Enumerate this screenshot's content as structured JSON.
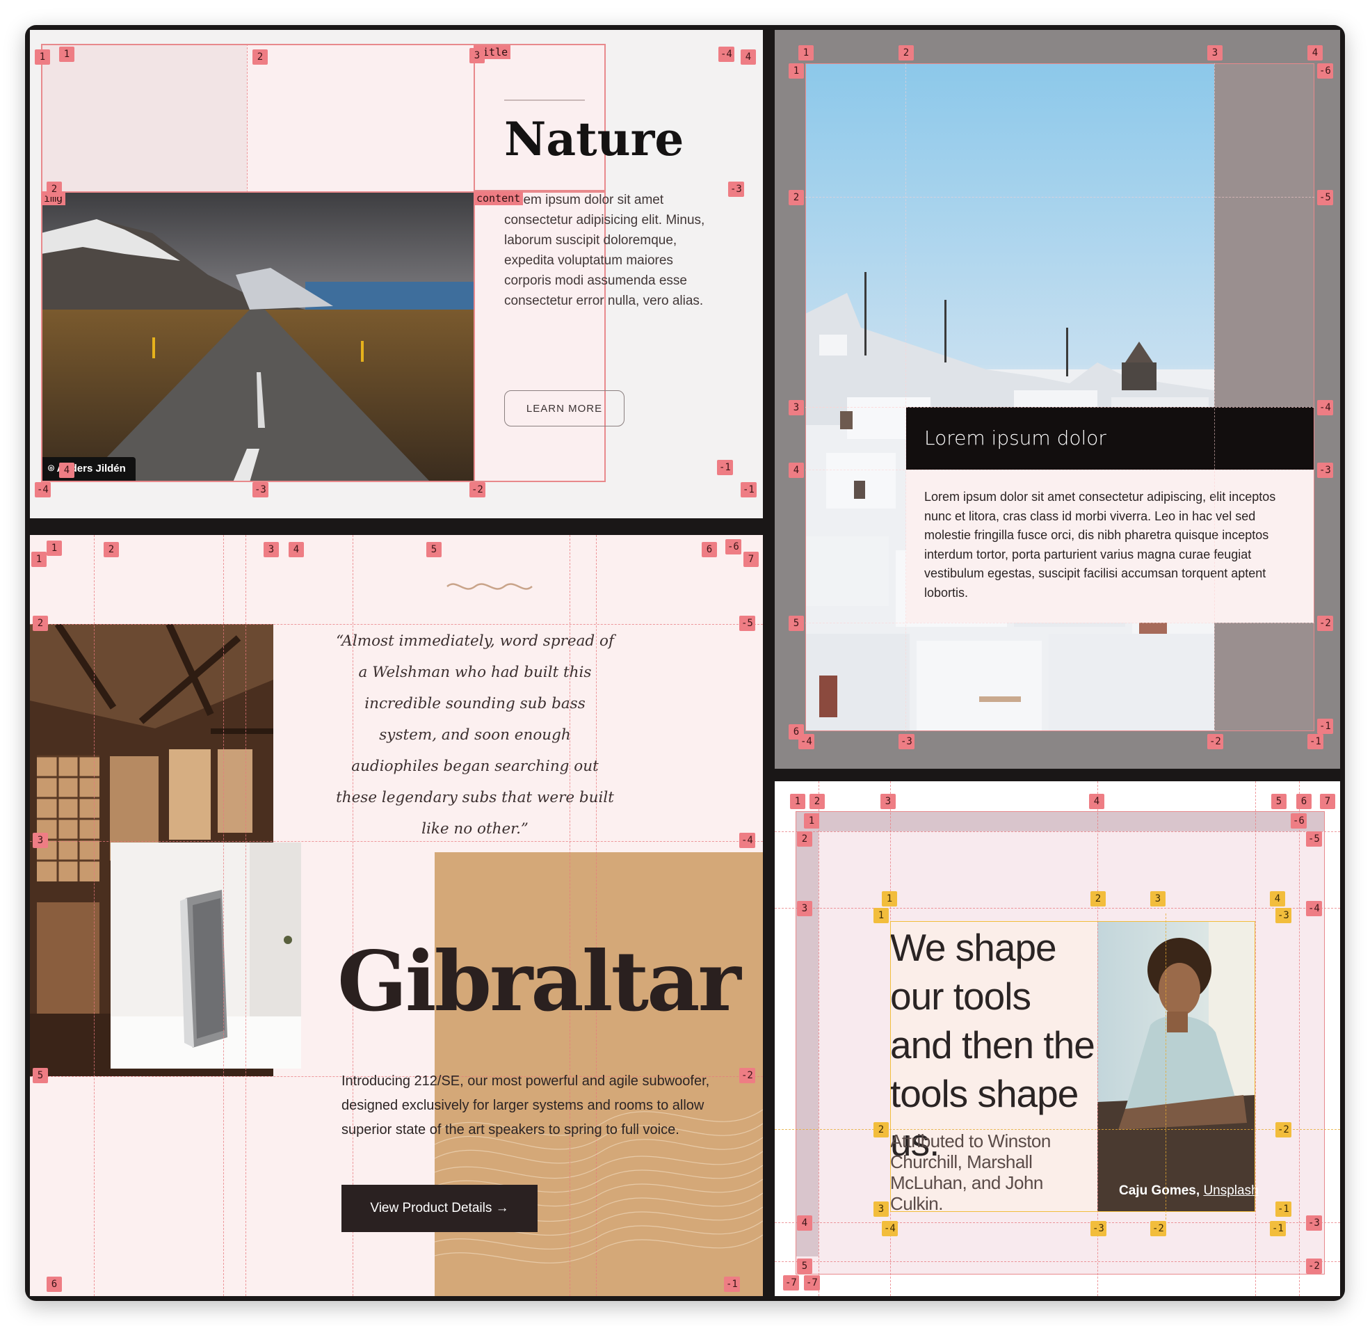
{
  "nature": {
    "title": "Nature",
    "body": "Lorem ipsum dolor sit amet consectetur adipisicing elit. Minus, laborum suscipit doloremque, expedita voluptatum maiores corporis modi assumenda esse consectetur error nulla, vero alias.",
    "button": "LEARN MORE",
    "photo_credit": "Anders Jildén",
    "area_tags": [
      "title",
      "content",
      "img"
    ],
    "grid_labels": [
      "1",
      "2",
      "3",
      "4",
      "-4",
      "-3",
      "-2",
      "-1"
    ]
  },
  "santorini": {
    "heading": "Lorem ipsum dolor",
    "body": "Lorem ipsum dolor sit amet consectetur adipiscing, elit inceptos nunc et litora, cras class id morbi viverra. Leo in hac vel sed molestie fringilla fusce orci, dis nibh pharetra quisque inceptos interdum tortor, porta parturient varius magna curae feugiat vestibulum egestas, suscipit facilisi accumsan torquent aptent lobortis."
  },
  "gibraltar": {
    "quote": "“Almost immediately, word spread of a Welshman who had built this incredible sounding sub bass system, and soon enough audiophiles began searching out these legendary subs that were built like no other.”",
    "title": "Gibraltar",
    "body": "Introducing 212/SE, our most powerful and agile subwoofer, designed exclusively for larger systems and rooms to allow superior state of the art speakers to spring to full voice.",
    "button": "View Product Details →"
  },
  "quote_card": {
    "quote": "We shape our tools and then the tools shape us.",
    "attribution": "Attributed to Winston Churchill, Marshall McLuhan, and John Culkin.",
    "credit_name": "Caju Gomes",
    "credit_sep": ", ",
    "credit_link": "Unsplash"
  },
  "colors": {
    "grid_line": "#e8898c",
    "subgrid_line": "#f2bd3c",
    "gibraltar_tan": "#d4a878"
  },
  "icons": [
    "camera-icon",
    "wave-ornament-icon",
    "arrow-right-icon"
  ]
}
